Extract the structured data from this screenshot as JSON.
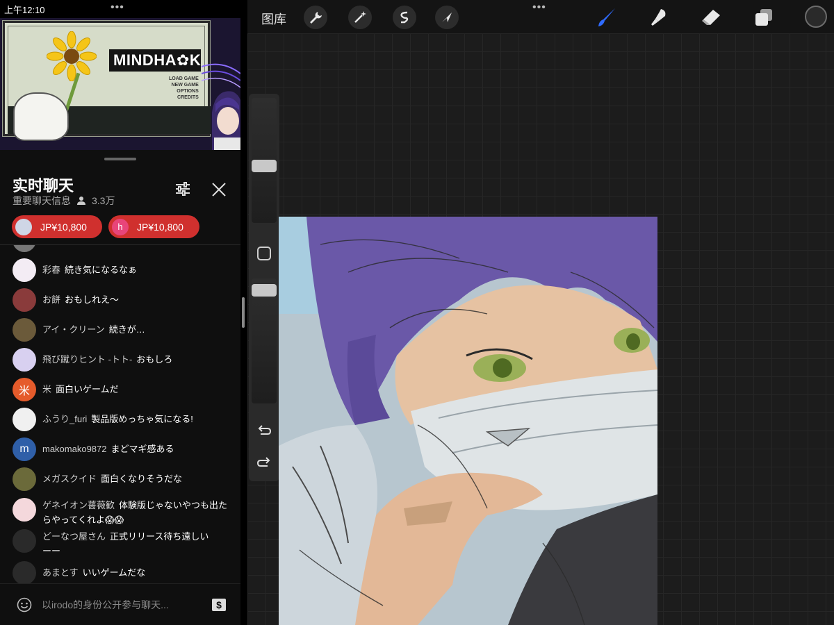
{
  "status": {
    "time": "上午12:10"
  },
  "video": {
    "game_title": "MINDHA✿K",
    "menu": [
      "LOAD GAME",
      "NEW GAME",
      "OPTIONS",
      "CREDITS"
    ]
  },
  "chat": {
    "title": "实时聊天",
    "subtitle": "重要聊天信息",
    "viewer_count": "3.3万",
    "tips": [
      {
        "avatar_letter": "",
        "avatar_color": "#cfd6e6",
        "amount": "JP¥10,800"
      },
      {
        "avatar_letter": "h",
        "avatar_color": "#e8457a",
        "amount": "JP¥10,800"
      }
    ],
    "messages": [
      {
        "author": "彩春",
        "text": "続き気になるなぁ",
        "avatar_color": "#f3ecf4",
        "avatar_letter": ""
      },
      {
        "author": "お餅",
        "text": "おもしれえ～",
        "avatar_color": "#8a3b3b",
        "avatar_letter": ""
      },
      {
        "author": "アイ・クリーン",
        "text": "続きが…",
        "avatar_color": "#6b5a3a",
        "avatar_letter": ""
      },
      {
        "author": "飛び蹴りヒント -トト-",
        "text": "おもしろ",
        "avatar_color": "#d8d0f0",
        "avatar_letter": ""
      },
      {
        "author": "米",
        "text": "面白いゲームだ",
        "avatar_color": "#e55b2b",
        "avatar_letter": "米"
      },
      {
        "author": "ふうり_furi",
        "text": "製品版めっちゃ気になる!",
        "avatar_color": "#f0f0f0",
        "avatar_letter": ""
      },
      {
        "author": "makomako9872",
        "text": "まどマギ感ある",
        "avatar_color": "#2f5fa8",
        "avatar_letter": "m"
      },
      {
        "author": "メガスクイド",
        "text": "面白くなりそうだな",
        "avatar_color": "#6b6a3a",
        "avatar_letter": ""
      },
      {
        "author": "ゲネイオン薔薇歓",
        "text": "体験版じゃないやつも出たらやってくれよ😱😱",
        "avatar_color": "#f4d8dc",
        "avatar_letter": ""
      },
      {
        "author": "どーなつ屋さん",
        "text": "正式リリース待ち遠しいーー",
        "avatar_color": "#2a2a2a",
        "avatar_letter": ""
      },
      {
        "author": "あまとす",
        "text": "いいゲームだな",
        "avatar_color": "#2a2a2a",
        "avatar_letter": ""
      }
    ],
    "input_placeholder": "以irodo的身份公开参与聊天..."
  },
  "procreate": {
    "gallery_label": "图库",
    "tools": [
      "wrench-icon",
      "magic-wand-icon",
      "selection-icon",
      "transform-arrow-icon"
    ],
    "brush_tools": [
      "paint-brush-icon",
      "smudge-icon",
      "eraser-icon",
      "layers-icon"
    ],
    "brush_color": "#2f6bff",
    "size_level": 0.45,
    "opacity_level": 0.95
  }
}
